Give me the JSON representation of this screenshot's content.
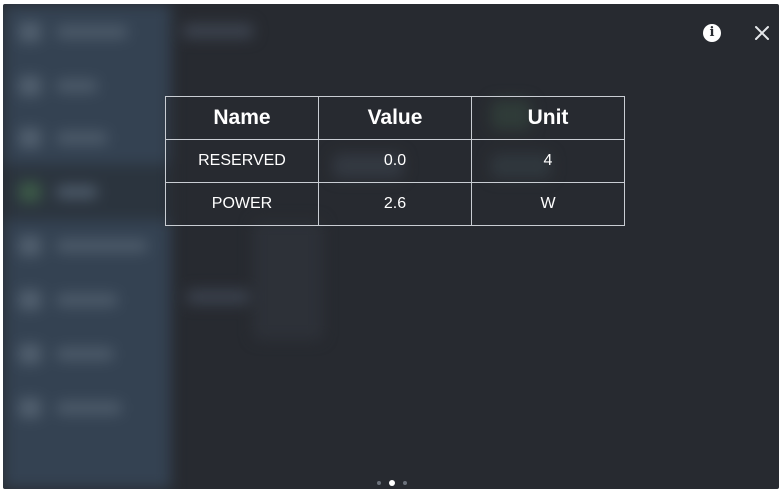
{
  "dialog": {
    "info_icon": "info-icon",
    "close_icon": "close-icon"
  },
  "table": {
    "headers": [
      "Name",
      "Value",
      "Unit"
    ],
    "rows": [
      [
        "RESERVED",
        "0.0",
        "4"
      ],
      [
        "POWER",
        "2.6",
        "W"
      ]
    ]
  },
  "pager": {
    "total": 3,
    "active_index": 1
  },
  "colors": {
    "background": "#272a30",
    "sidebar": "#344252",
    "table_border": "#c9cdd3",
    "text": "#ffffff"
  }
}
